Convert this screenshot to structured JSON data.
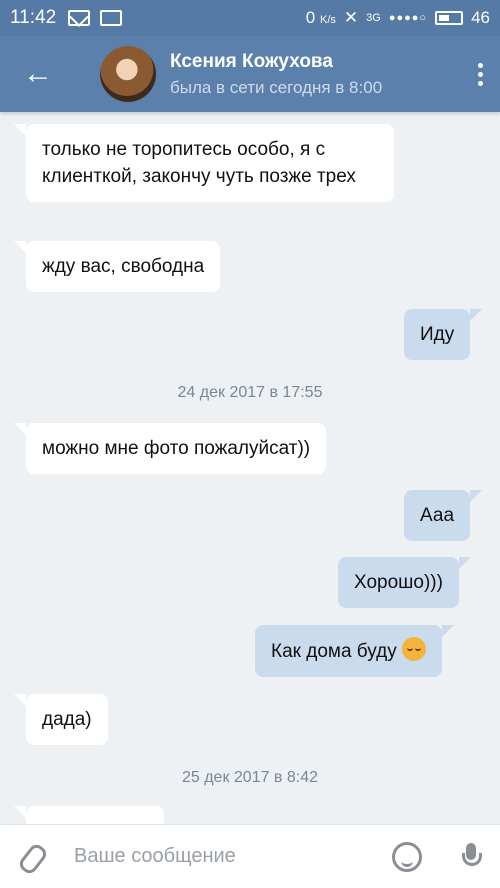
{
  "status_bar": {
    "time": "11:42",
    "speed": "0",
    "speed_unit": "K/s",
    "network": "3G",
    "signal_dots": "●●●●○",
    "battery": "46"
  },
  "header": {
    "name": "Ксения Кожухова",
    "status": "была в сети сегодня в 8:00"
  },
  "messages": [
    {
      "dir": "in",
      "text": "только не торопитесь особо, я с клиенткой, закончу чуть позже трех"
    },
    {
      "dir": "in",
      "text": "жду вас, свободна"
    },
    {
      "dir": "out",
      "text": "Иду"
    },
    {
      "dir": "date",
      "text": "24 дек 2017 в 17:55"
    },
    {
      "dir": "in",
      "text": "можно мне фото пожалуйсат))"
    },
    {
      "dir": "out",
      "text": "Ааа"
    },
    {
      "dir": "out",
      "text": "Хорошо)))"
    },
    {
      "dir": "out",
      "text": "Как дома буду",
      "emoji": "relieved-face"
    },
    {
      "dir": "in",
      "text": "дада)"
    },
    {
      "dir": "date",
      "text": "25 дек 2017 в 8:42"
    }
  ],
  "composer": {
    "placeholder": "Ваше сообщение"
  }
}
